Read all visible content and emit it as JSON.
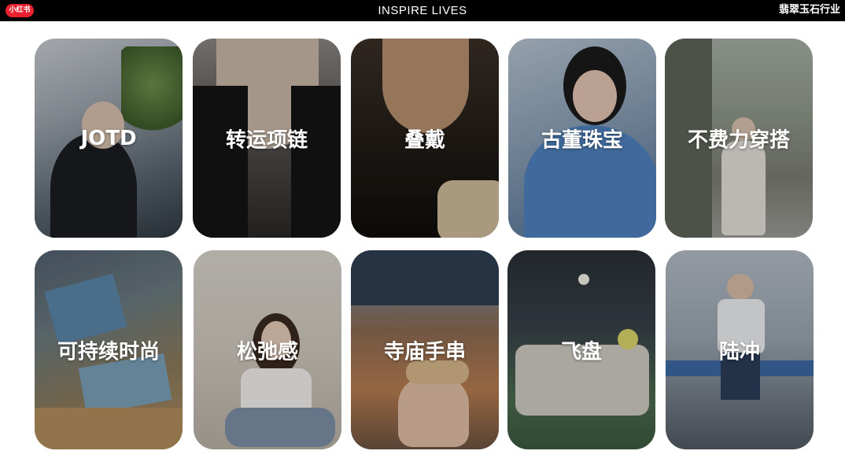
{
  "header": {
    "logo_text": "小红书",
    "title": "INSPIRE LIVES",
    "tag": "翡翠玉石行业"
  },
  "cards": [
    {
      "label": "JOTD",
      "photo": "woman-in-cap-street-photo"
    },
    {
      "label": "转运项链",
      "photo": "black-cord-necklace-photo"
    },
    {
      "label": "叠戴",
      "photo": "layered-pearl-necklace-photo"
    },
    {
      "label": "古董珠宝",
      "photo": "woman-blue-shirt-photo"
    },
    {
      "label": "不费力穿搭",
      "photo": "street-outfit-photo"
    },
    {
      "label": "可持续时尚",
      "photo": "handmade-crafts-table-photo"
    },
    {
      "label": "松弛感",
      "photo": "woman-sitting-sofa-photo"
    },
    {
      "label": "寺庙手串",
      "photo": "temple-bead-bracelets-photo"
    },
    {
      "label": "飞盘",
      "photo": "frisbee-group-photo"
    },
    {
      "label": "陆冲",
      "photo": "surfskate-rider-photo"
    }
  ],
  "colors": {
    "topbar": "#000000",
    "logo_badge": "#e8202f",
    "background": "#ffffff",
    "label": "#ffffff"
  }
}
